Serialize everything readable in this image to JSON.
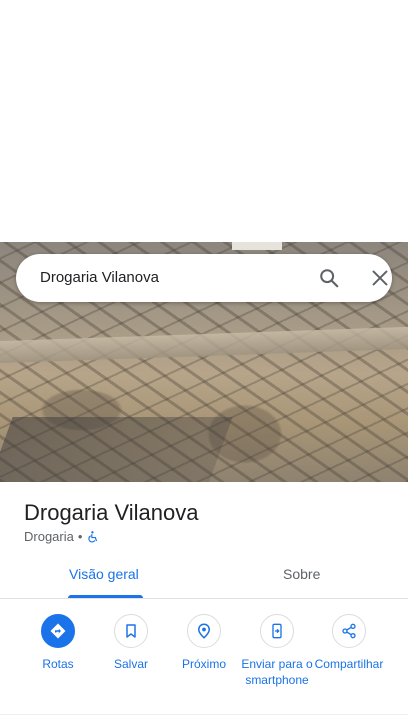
{
  "search": {
    "query": "Drogaria Vilanova"
  },
  "place": {
    "name": "Drogaria Vilanova",
    "category": "Drogaria",
    "separator": "•"
  },
  "tabs": [
    {
      "label": "Visão geral",
      "active": true
    },
    {
      "label": "Sobre",
      "active": false
    }
  ],
  "actions": [
    {
      "label": "Rotas",
      "icon": "directions-icon"
    },
    {
      "label": "Salvar",
      "icon": "bookmark-icon"
    },
    {
      "label": "Próximo",
      "icon": "nearby-icon"
    },
    {
      "label": "Enviar para o smartphone",
      "icon": "send-to-phone-icon"
    },
    {
      "label": "Compartilhar",
      "icon": "share-icon"
    }
  ],
  "colors": {
    "accent": "#1a73e8",
    "text": "#202124",
    "secondary": "#5f6368"
  }
}
